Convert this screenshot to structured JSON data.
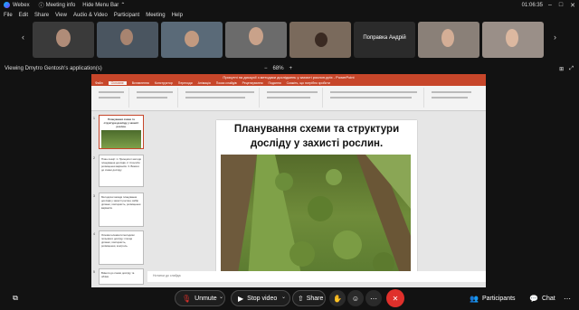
{
  "app": {
    "name": "Webex",
    "meeting_info": "Meeting info",
    "hide_menu": "Hide Menu Bar",
    "time": "01:06:35"
  },
  "menu": [
    "File",
    "Edit",
    "Share",
    "View",
    "Audio & Video",
    "Participant",
    "Meeting",
    "Help"
  ],
  "participants": [
    {
      "name": "",
      "bg": "#3a3a3a"
    },
    {
      "name": "",
      "bg": "#4a5560"
    },
    {
      "name": "",
      "bg": "#5a6a78"
    },
    {
      "name": "",
      "bg": "#6b6b6b"
    },
    {
      "name": "",
      "bg": "#7a6a5c"
    },
    {
      "name": "Поправка Андрій",
      "bg": "#2b2b2b"
    },
    {
      "name": "",
      "bg": "#8a8078"
    },
    {
      "name": "",
      "bg": "#9a8f88"
    }
  ],
  "share": {
    "viewing_label": "Viewing Dmytro Gentosh's application(s)",
    "zoom": "68%"
  },
  "ppt": {
    "window_title": "Присутні на дискусії з методики досліджень у захисті рослин.pptx - PowerPoint",
    "tabs": [
      "Файл",
      "Основне",
      "Вставлення",
      "Конструктор",
      "Переходи",
      "Анімація",
      "Показ слайдів",
      "Рецензування",
      "Подання",
      "Скажіть, що потрібно зробити"
    ],
    "active_tab": "Основне",
    "slide_title": "Планування схеми та структури досліду у захисті рослин.",
    "notes_placeholder": "Нотатки до слайда",
    "slides": [
      {
        "num": "1",
        "text": "Планування схеми та структури досліду у захисті рослин."
      },
      {
        "num": "2",
        "text": "План лекції: 1. Принципи і методи планування дослідів. 2. Способи розміщення варіантів. 3. Вимоги до схеми досліду."
      },
      {
        "num": "3",
        "text": "Методичні засади планування дослідів у захисті рослин; вибір ділянки, повторність, розміщення варіантів."
      },
      {
        "num": "4",
        "text": "Основні елементи методики польового досліду: площа ділянки, повторність, розміщення, контроль."
      },
      {
        "num": "5",
        "text": "Вимоги до схеми досліду та обліки."
      }
    ]
  },
  "controls": {
    "unmute": "Unmute",
    "stop_video": "Stop video",
    "share": "Share",
    "participants": "Participants",
    "chat": "Chat"
  },
  "colors": {
    "end_call": "#e0302b",
    "ppt_accent": "#c7462a",
    "background": "#121212"
  }
}
